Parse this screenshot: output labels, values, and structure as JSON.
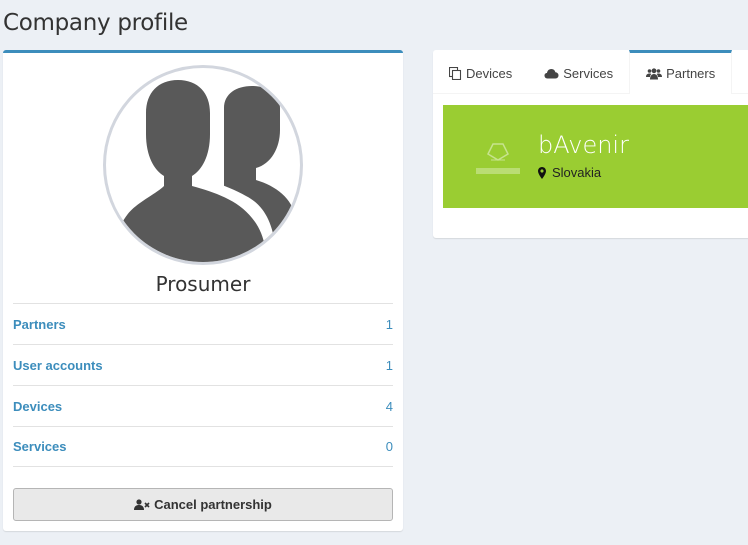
{
  "page": {
    "title": "Company profile"
  },
  "profile": {
    "name": "Prosumer",
    "stats": [
      {
        "label": "Partners",
        "value": "1"
      },
      {
        "label": "User accounts",
        "value": "1"
      },
      {
        "label": "Devices",
        "value": "4"
      },
      {
        "label": "Services",
        "value": "0"
      }
    ],
    "cancel_label": "Cancel partnership"
  },
  "tabs": [
    {
      "label": "Devices",
      "icon": "copy-icon"
    },
    {
      "label": "Services",
      "icon": "cloud-icon"
    },
    {
      "label": "Partners",
      "icon": "users-icon",
      "active": true
    }
  ],
  "partner": {
    "name": "bAvenir",
    "location": "Slovakia",
    "card_color": "#9acd32"
  },
  "colors": {
    "accent": "#3c8dbc",
    "background": "#ecf0f5"
  }
}
